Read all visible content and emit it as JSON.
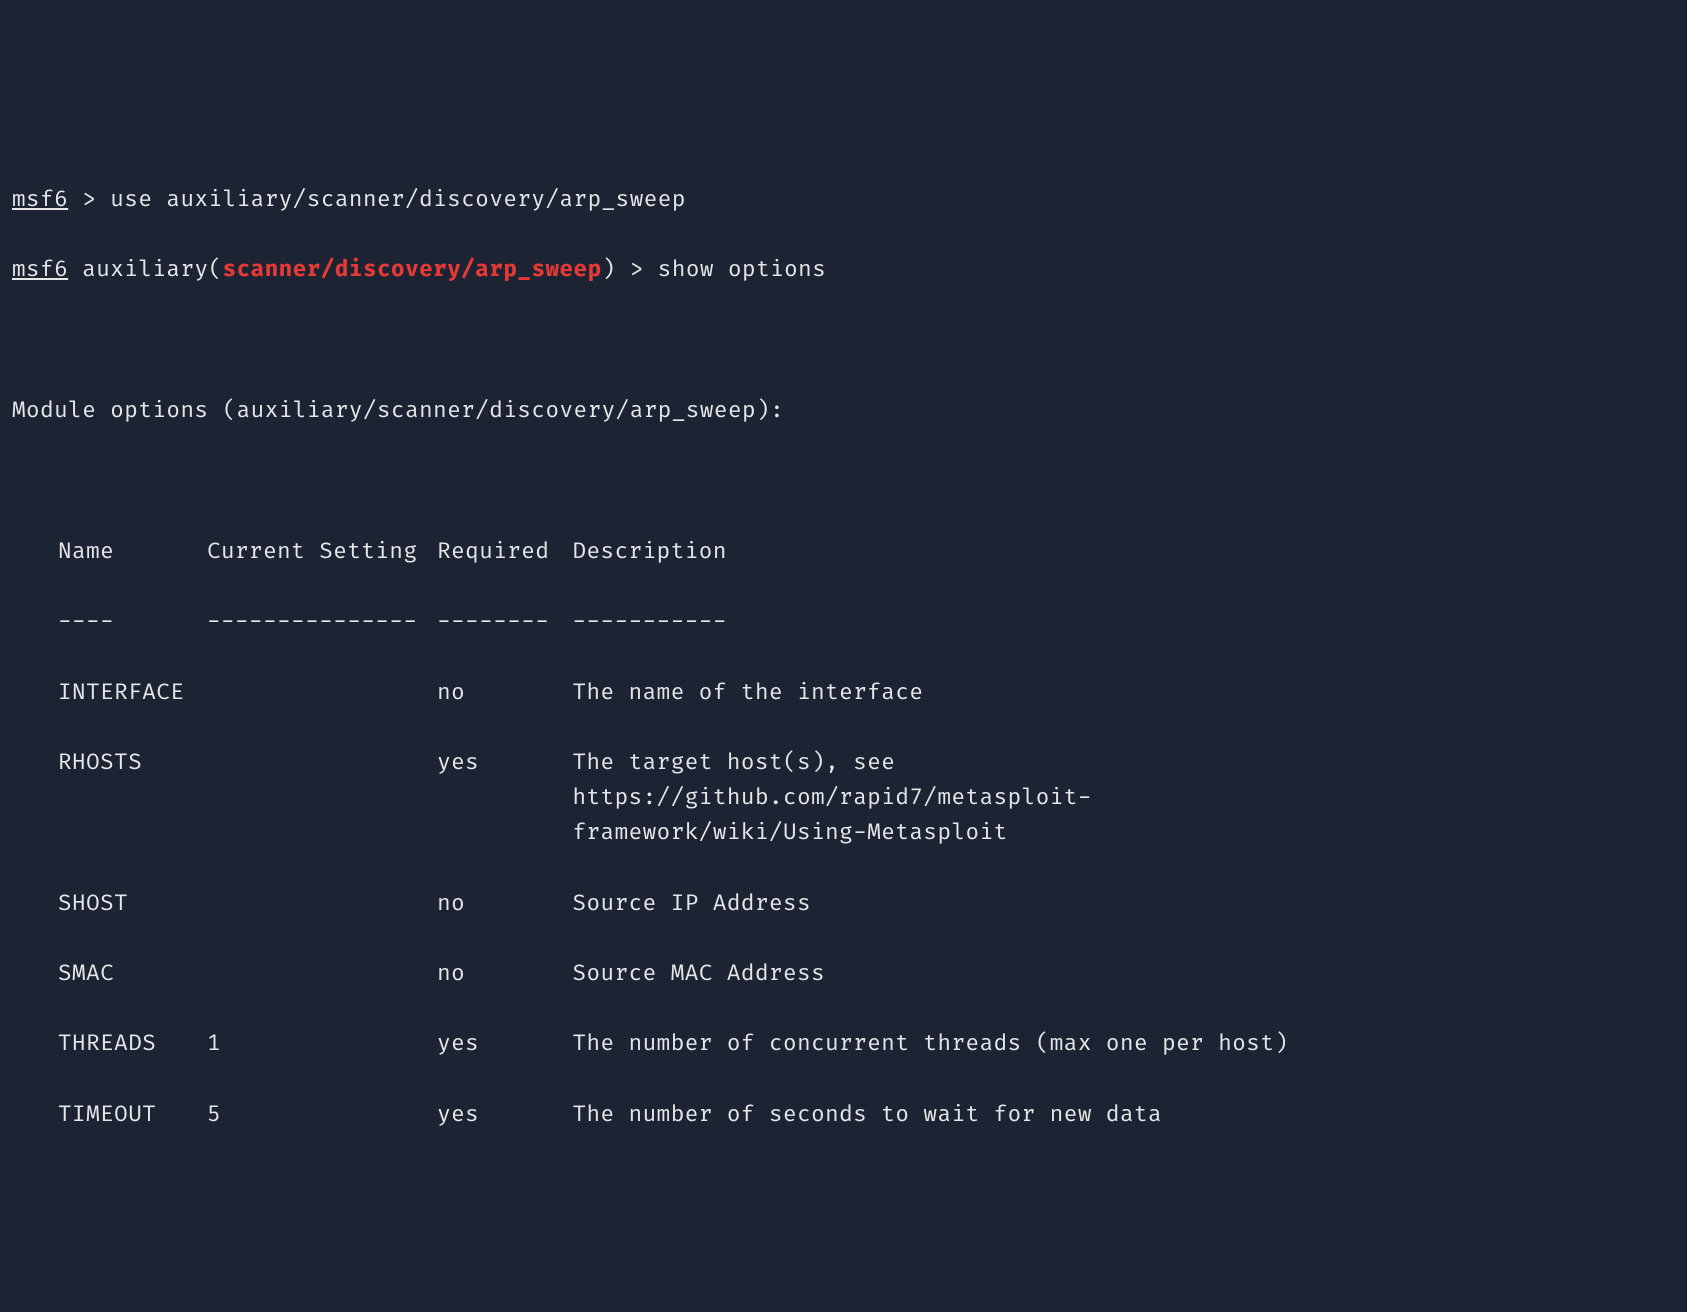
{
  "prompt1_prefix": "msf6",
  "prompt1_rest": " > ",
  "cmd1": "use auxiliary/scanner/discovery/arp_sweep",
  "prompt2_prefix": "msf6",
  "prompt2_between": " auxiliary(",
  "module_path_red": "scanner/discovery/arp_sweep",
  "prompt2_after": ") > ",
  "cmd2": "show options",
  "module_header": "Module options (auxiliary/scanner/discovery/arp_sweep):",
  "headers": {
    "name": "Name",
    "setting": "Current Setting",
    "required": "Required",
    "description": "Description"
  },
  "underline": {
    "name": "----",
    "setting": "---------------",
    "required": "--------",
    "description": "-----------"
  },
  "options": [
    {
      "name": "INTERFACE",
      "setting": "",
      "required": "no",
      "description": "The name of the interface"
    },
    {
      "name": "RHOSTS",
      "setting": "",
      "required": "yes",
      "description": "The target host(s), see https://github.com/rapid7/metasploit-framework/wiki/Using-Metasploit"
    },
    {
      "name": "SHOST",
      "setting": "",
      "required": "no",
      "description": "Source IP Address"
    },
    {
      "name": "SMAC",
      "setting": "",
      "required": "no",
      "description": "Source MAC Address"
    },
    {
      "name": "THREADS",
      "setting": "1",
      "required": "yes",
      "description": "The number of concurrent threads (max one per host)"
    },
    {
      "name": "TIMEOUT",
      "setting": "5",
      "required": "yes",
      "description": "The number of seconds to wait for new data"
    }
  ]
}
